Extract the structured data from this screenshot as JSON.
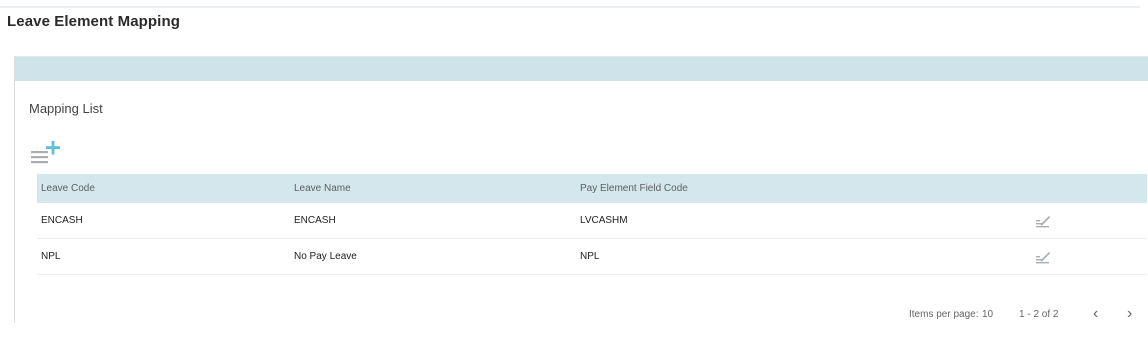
{
  "page": {
    "title": "Leave Element Mapping"
  },
  "section": {
    "title": "Mapping List",
    "add_icon": "list-add-icon"
  },
  "table": {
    "columns": [
      "Leave Code",
      "Leave Name",
      "Pay Element Field Code",
      ""
    ],
    "rows": [
      {
        "code": "ENCASH",
        "name": "ENCASH",
        "field_code": "LVCASHM",
        "action_icon": "edit-icon"
      },
      {
        "code": "NPL",
        "name": "No Pay Leave",
        "field_code": "NPL",
        "action_icon": "edit-icon"
      }
    ]
  },
  "pagination": {
    "items_per_page_label": "Items per page:",
    "items_per_page": "10",
    "range": "1 - 2 of 2",
    "prev_icon": "chevron-left-icon",
    "next_icon": "chevron-right-icon"
  },
  "colors": {
    "header_bar": "#cfe4ea",
    "table_header": "#d4e7ed",
    "icon": "#a9aeb2",
    "add_accent": "#5cc0d8"
  }
}
